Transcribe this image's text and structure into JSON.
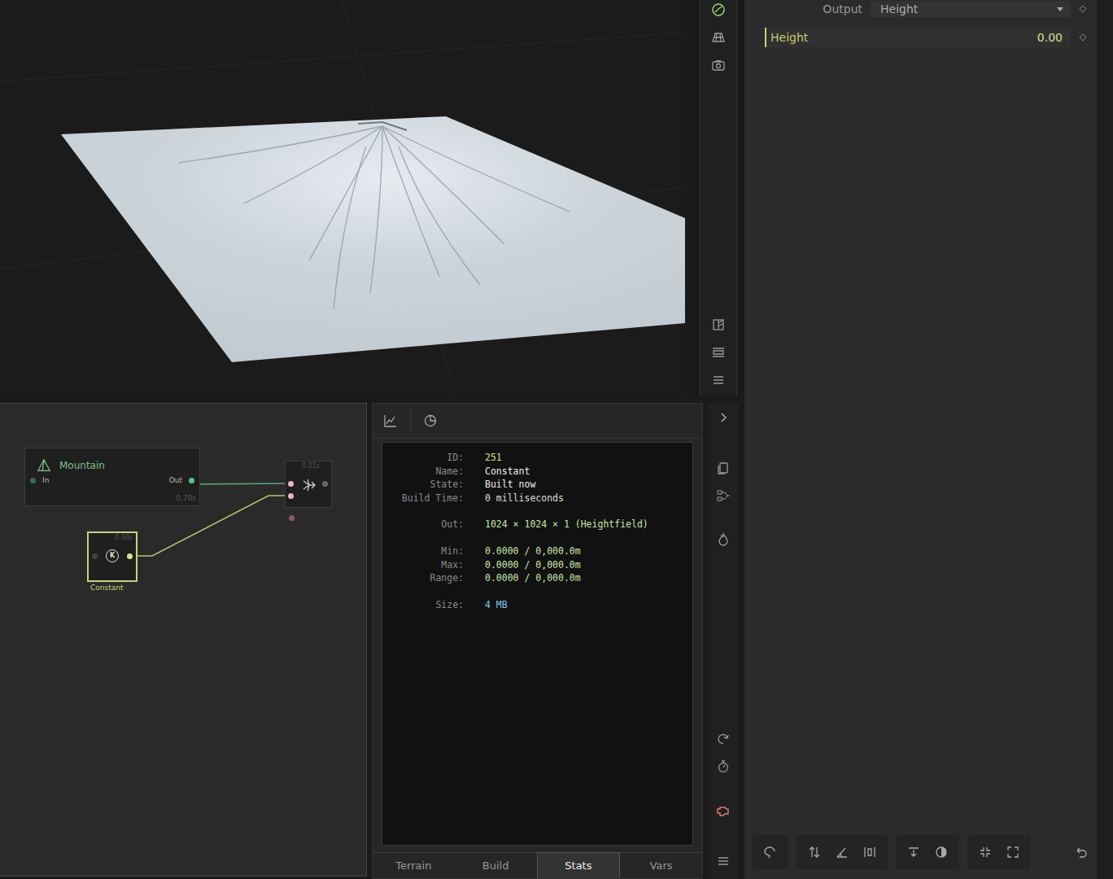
{
  "properties": {
    "output_label": "Output",
    "output_value": "Height",
    "params": [
      {
        "label": "Height",
        "value": "0.00"
      }
    ]
  },
  "graph": {
    "mountain": {
      "title": "Mountain",
      "in": "In",
      "out": "Out",
      "time": "0.70s",
      "selected": false
    },
    "combine": {
      "time": "0.01s",
      "selected": false
    },
    "constant": {
      "label": "Constant",
      "glyph": "K",
      "time": "0.00s",
      "selected": true
    }
  },
  "stats": {
    "groups": [
      [
        {
          "label": "ID:",
          "value": "251",
          "color": "#d8e08a"
        },
        {
          "label": "Name:",
          "value": "Constant",
          "color": "#eeeeee"
        },
        {
          "label": "State:",
          "value": "Built now",
          "color": "#eeeeee"
        },
        {
          "label": "Build Time:",
          "value": "0 milliseconds",
          "color": "#dddddd"
        }
      ],
      [
        {
          "label": "Out:",
          "value": "1024 × 1024 × 1 (Heightfield)",
          "color": "#c7e6a8"
        }
      ],
      [
        {
          "label": "Min:",
          "value": "0.0000 / 0,000.0m",
          "color": "#c7e6a8"
        },
        {
          "label": "Max:",
          "value": "0.0000 / 0,000.0m",
          "color": "#c7e6a8"
        },
        {
          "label": "Range:",
          "value": "0.0000 / 0,000.0m",
          "color": "#c7e6a8"
        }
      ],
      [
        {
          "label": "Size:",
          "value": "4 MB",
          "color": "#7ec8e8"
        }
      ]
    ]
  },
  "tabs": [
    {
      "label": "Terrain",
      "selected": false
    },
    {
      "label": "Build",
      "selected": false
    },
    {
      "label": "Stats",
      "selected": true
    },
    {
      "label": "Vars",
      "selected": false
    }
  ]
}
